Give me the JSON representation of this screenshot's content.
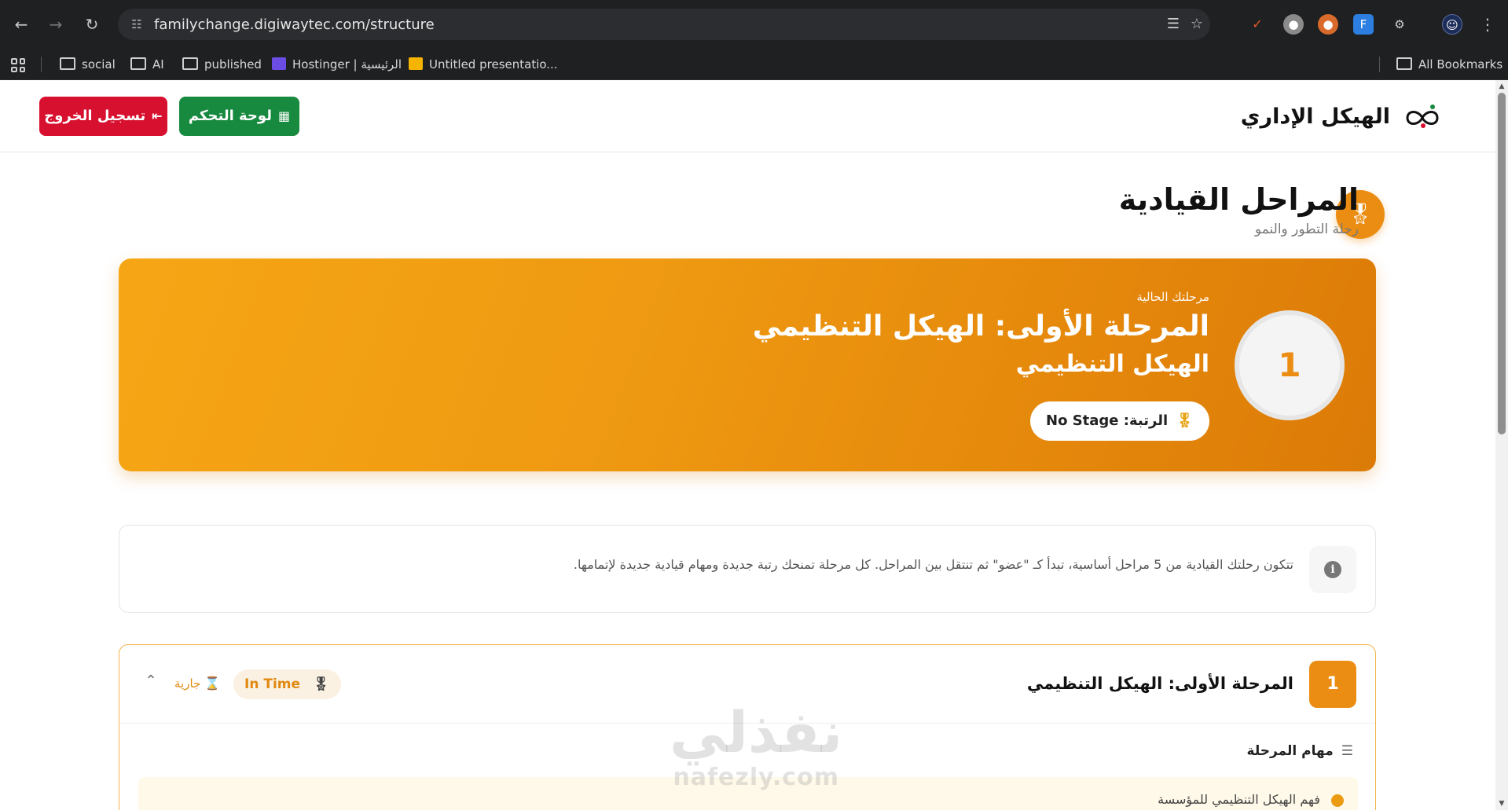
{
  "browser": {
    "url": "familychange.digiwaytec.com/structure",
    "bookmarks": [
      {
        "label": "social"
      },
      {
        "label": "AI"
      },
      {
        "label": "published"
      },
      {
        "label": "Hostinger | الرئيسية"
      },
      {
        "label": "Untitled presentatio..."
      }
    ],
    "all_bookmarks": "All Bookmarks"
  },
  "header": {
    "brand_title": "الهيكل الإداري",
    "dashboard_label": "لوحة التحكم",
    "logout_label": "تسجيل الخروج"
  },
  "section": {
    "title": "المراحل القيادية",
    "subtitle": "رحلة التطور والنمو"
  },
  "hero": {
    "current_label": "مرحلتك الحالية",
    "stage_title": "المرحلة الأولى: الهيكل التنظيمي",
    "stage_subtitle": "الهيكل التنظيمي",
    "rank_label": "الرتبة: No Stage",
    "stage_number": "1"
  },
  "info": {
    "text": "تتكون رحلتك القيادية من 5 مراحل أساسية، تبدأ كـ \"عضو\" ثم تنتقل بين المراحل. كل مرحلة تمنحك رتبة جديدة ومهام قيادية جديدة لإتمامها."
  },
  "stage_card": {
    "number": "1",
    "title": "المرحلة الأولى: الهيكل التنظيمي",
    "in_time_label": "In Time",
    "status_label": "جارية",
    "tasks_heading": "مهام المرحلة",
    "tasks": [
      {
        "label": "فهم الهيكل التنظيمي للمؤسسة"
      }
    ]
  },
  "watermark": {
    "arabic": "نفذلي",
    "latin": "nafezly.com"
  },
  "colors": {
    "accent": "#eb8d12",
    "logout": "#d7102f",
    "dashboard": "#178a3f"
  }
}
